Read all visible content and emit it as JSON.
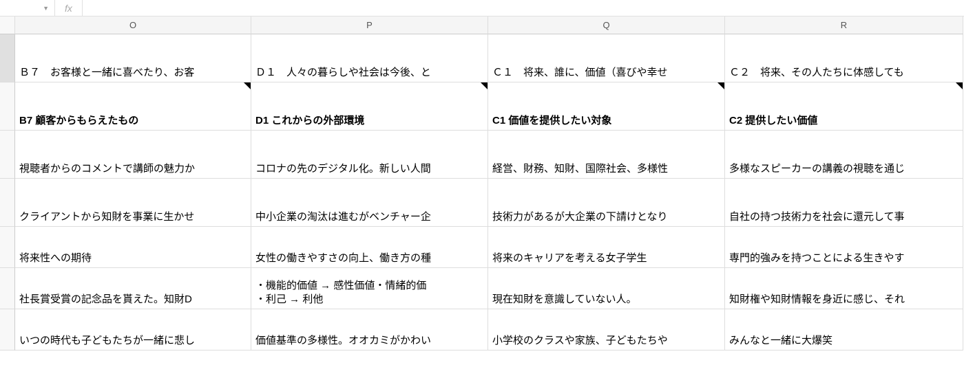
{
  "formula_bar": {
    "fx_label": "fx",
    "value": ""
  },
  "columns": [
    "O",
    "P",
    "Q",
    "R"
  ],
  "rows": [
    {
      "height_class": "cell-tall",
      "cells": [
        {
          "text": "Ｂ７　お客様と一緒に喜べたり、お客",
          "note": false
        },
        {
          "text": "Ｄ１　人々の暮らしや社会は今後、と",
          "note": false
        },
        {
          "text": "Ｃ１　将来、誰に、価値（喜びや幸せ",
          "note": false
        },
        {
          "text": "Ｃ２　将来、その人たちに体感しても",
          "note": false
        }
      ],
      "active": true
    },
    {
      "height_class": "cell-tall2",
      "cells": [
        {
          "text": "B7 顧客からもらえたもの",
          "bold": true,
          "note": true
        },
        {
          "text": "D1 これからの外部環境",
          "bold": true,
          "note": true
        },
        {
          "text": "C1 価値を提供したい対象",
          "bold": true,
          "note": true
        },
        {
          "text": "C2 提供したい価値",
          "bold": true,
          "note": true
        }
      ]
    },
    {
      "height_class": "cell-tall2",
      "cells": [
        {
          "text": "視聴者からのコメントで講師の魅力か",
          "note": false
        },
        {
          "text": "コロナの先のデジタル化。新しい人間",
          "note": false
        },
        {
          "text": "経営、財務、知財、国際社会、多様性",
          "note": false
        },
        {
          "text": "多様なスピーカーの講義の視聴を通じ",
          "note": false
        }
      ]
    },
    {
      "height_class": "cell-tall2",
      "cells": [
        {
          "text": "クライアントから知財を事業に生かせ",
          "note": false
        },
        {
          "text": "中小企業の淘汰は進むがベンチャー企",
          "note": false
        },
        {
          "text": "技術力があるが大企業の下請けとなり",
          "note": false
        },
        {
          "text": "自社の持つ技術力を社会に還元して事",
          "note": false
        }
      ]
    },
    {
      "height_class": "cell-short",
      "cells": [
        {
          "text": "将来性への期待",
          "note": false
        },
        {
          "text": "女性の働きやすさの向上、働き方の種",
          "note": false
        },
        {
          "text": "将来のキャリアを考える女子学生",
          "note": false
        },
        {
          "text": "専門的強みを持つことによる生きやす",
          "note": false
        }
      ]
    },
    {
      "height_class": "cell-short",
      "cells": [
        {
          "text": "社長賞受賞の記念品を貰えた。知財D",
          "note": false
        },
        {
          "text": "・機能的価値 → 感性価値・情緒的価\n・利己 → 利他",
          "multiline": true,
          "note": false
        },
        {
          "text": "現在知財を意識していない人。",
          "note": false
        },
        {
          "text": "知財権や知財情報を身近に感じ、それ",
          "note": false
        }
      ]
    },
    {
      "height_class": "cell-short",
      "cells": [
        {
          "text": "いつの時代も子どもたちが一緒に悲し",
          "note": false
        },
        {
          "text": "価値基準の多様性。オオカミがかわい",
          "note": false
        },
        {
          "text": "小学校のクラスや家族、子どもたちや",
          "note": false
        },
        {
          "text": "みんなと一緒に大爆笑",
          "note": false
        }
      ]
    }
  ]
}
